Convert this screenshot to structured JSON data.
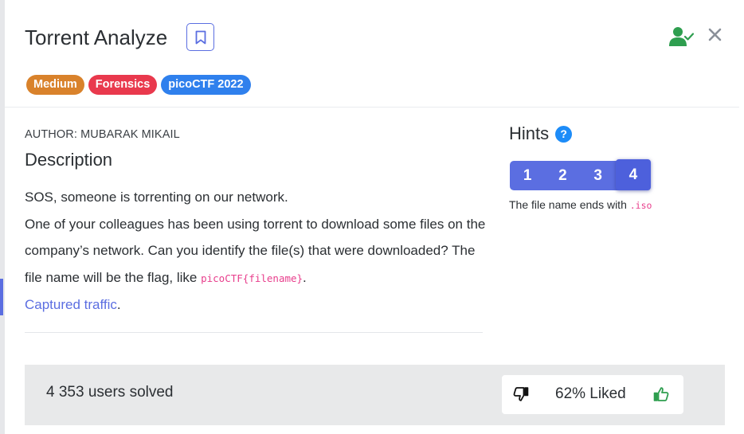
{
  "challenge": {
    "title": "Torrent Analyze",
    "tags": [
      "Medium",
      "Forensics",
      "picoCTF 2022"
    ]
  },
  "author": "AUTHOR: MUBARAK MIKAIL",
  "description": {
    "heading": "Description",
    "line1": "SOS, someone is torrenting on our network.",
    "line2_pre": "One of your colleagues has been using torrent to download some files on the company’s network. Can you identify the file(s) that were downloaded? The file name will be the flag, like ",
    "flag_format": "picoCTF{filename}",
    "line2_post": ".",
    "link_text": "Captured traffic",
    "link_post": "."
  },
  "hints": {
    "title": "Hints",
    "help_symbol": "?",
    "tabs": [
      "1",
      "2",
      "3",
      "4"
    ],
    "active_tab": "4",
    "text_pre": "The file name ends with ",
    "text_code": ".iso"
  },
  "stats": {
    "solved": "4 353 users solved",
    "liked": "62% Liked"
  },
  "colors": {
    "accent": "#5b6ee1",
    "medium": "#d9822b",
    "forensics": "#e9394d",
    "event": "#2f80ed",
    "user_check": "#2e9e4f",
    "code": "#e83e8c"
  },
  "icons": {
    "bookmark": "bookmark-icon",
    "user_check": "user-check-icon",
    "close": "close-icon",
    "help": "question-circle-icon",
    "thumbs_down": "thumbs-down-icon",
    "thumbs_up": "thumbs-up-icon"
  }
}
